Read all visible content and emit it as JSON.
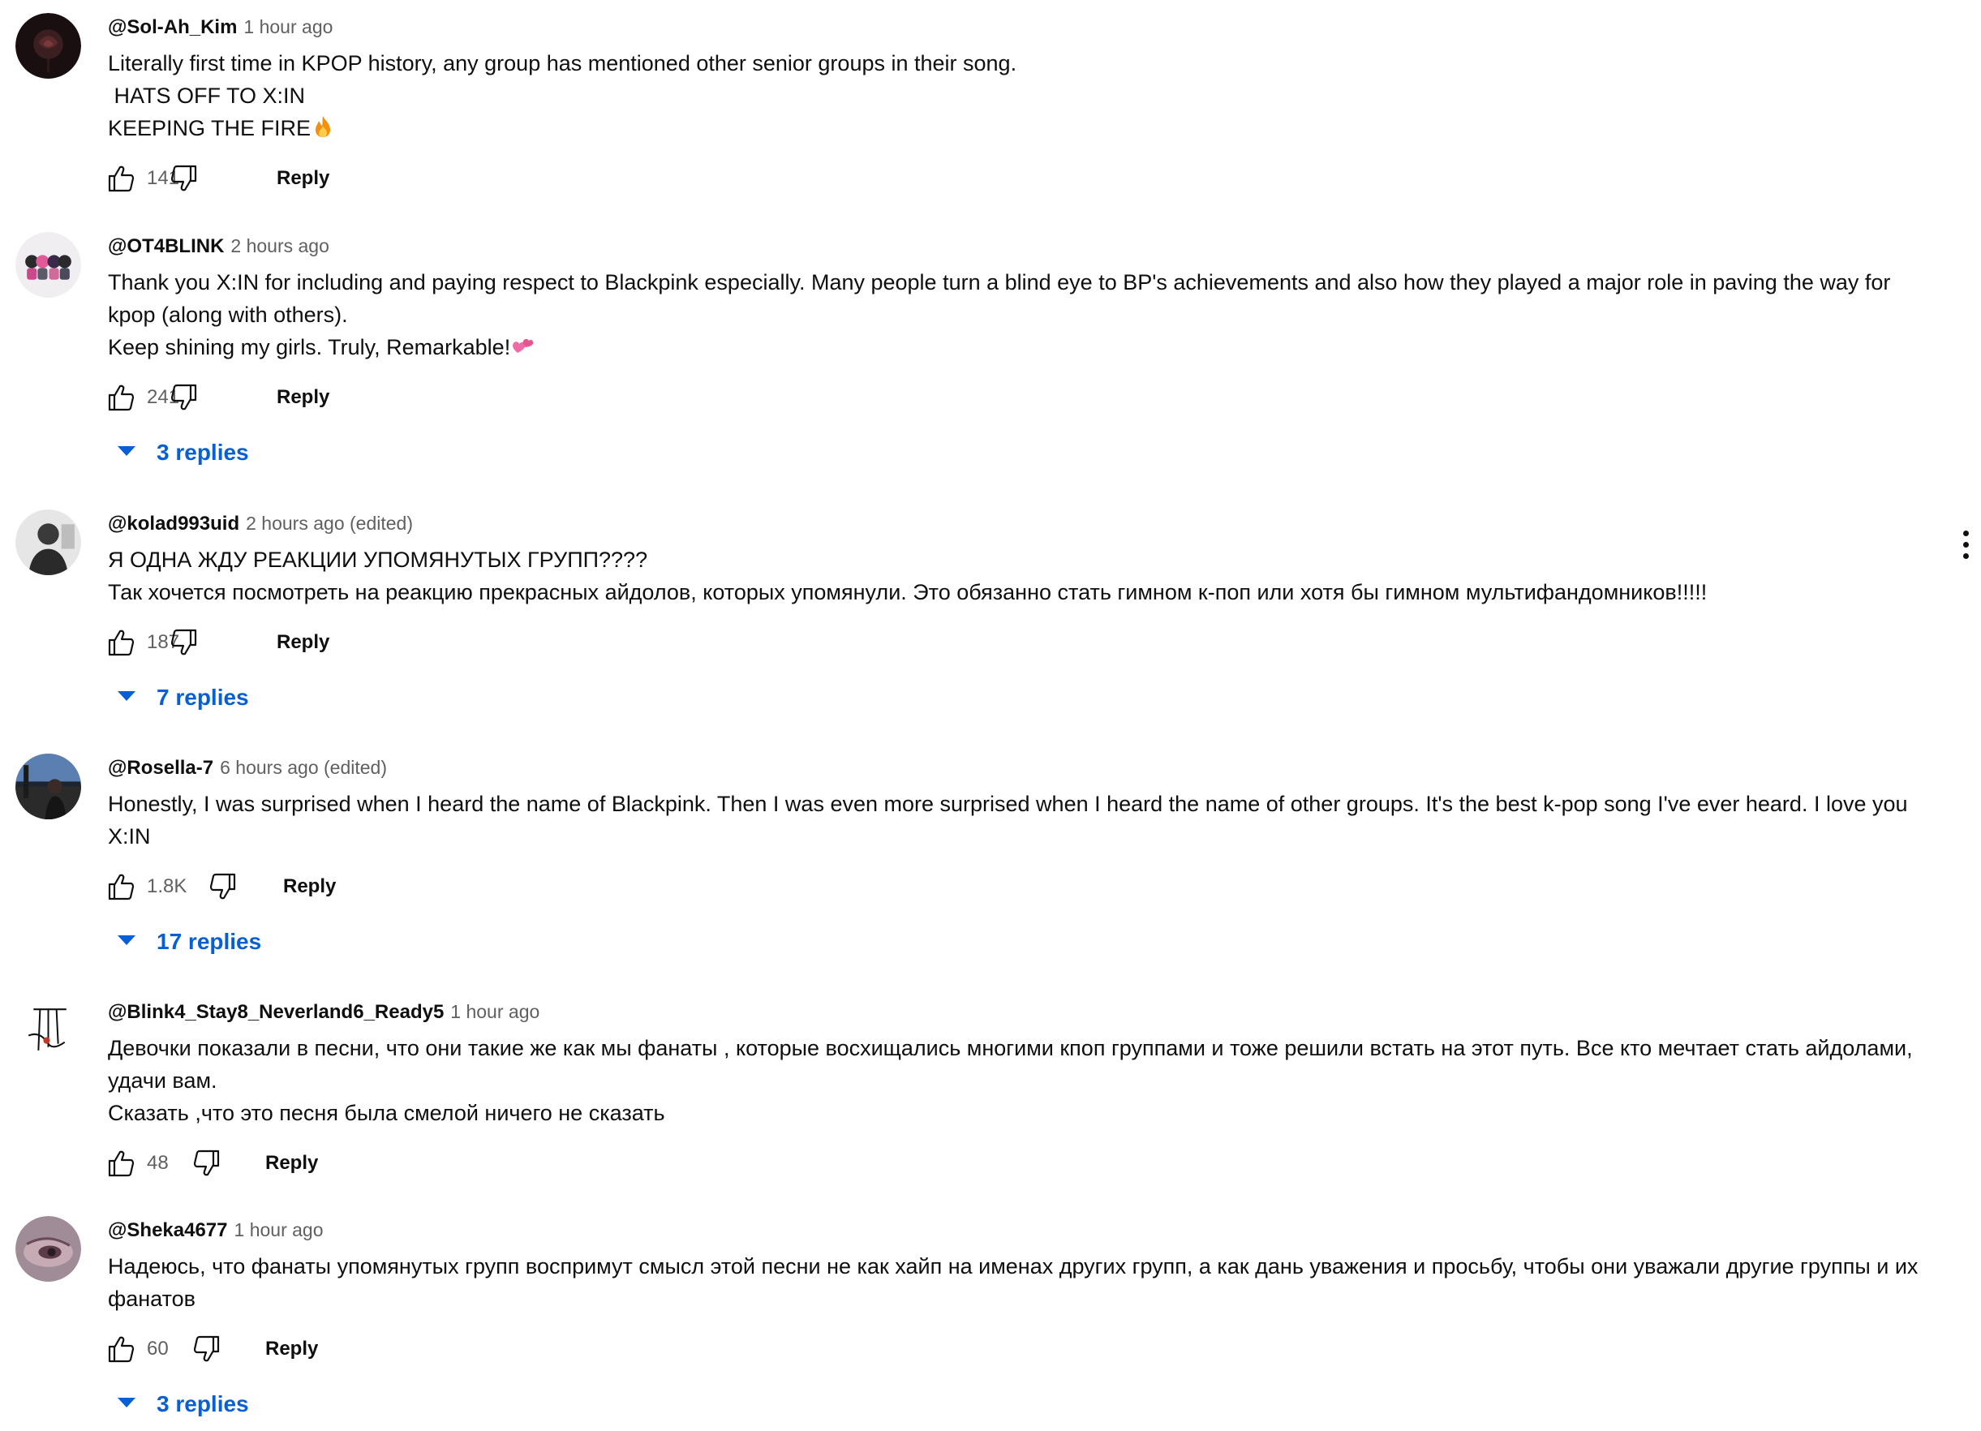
{
  "comments": [
    {
      "author": "@Sol-Ah_Kim",
      "time": "1 hour ago",
      "text": "Literally first time in KPOP history, any group has mentioned other senior groups in their song.\n HATS OFF TO X:IN\nKEEPING THE FIRE",
      "emoji": "fire-emoji",
      "likes": "141",
      "reply_label": "Reply"
    },
    {
      "author": "@OT4BLINK",
      "time": "2 hours ago",
      "text": "Thank you X:IN for including and paying respect to Blackpink especially. Many people turn a blind eye to BP's achievements and also how they played a major role in paving the way for kpop (along with others).\nKeep shining my girls. Truly, Remarkable!",
      "emoji": "two-hearts-emoji",
      "likes": "241",
      "reply_label": "Reply",
      "replies_label": "3 replies"
    },
    {
      "author": "@kolad993uid",
      "time": "2 hours ago (edited)",
      "text": "Я ОДНА ЖДУ РЕАКЦИИ УПОМЯНУТЫХ ГРУПП????\nТак хочется посмотреть на реакцию прекрасных айдолов, которых упомянули. Это обязанно стать гимном к-поп или хотя бы гимном мультифандомников!!!!!",
      "likes": "187",
      "reply_label": "Reply",
      "replies_label": "7 replies"
    },
    {
      "author": "@Rosella-7",
      "time": "6 hours ago (edited)",
      "text": "Honestly, I was surprised when I heard the name of Blackpink. Then I was even more surprised when I heard the name of other groups. It's the best k-pop song I've ever heard. I love you X:IN",
      "likes": "1.8K",
      "reply_label": "Reply",
      "replies_label": "17 replies"
    },
    {
      "author": "@Blink4_Stay8_Neverland6_Ready5",
      "time": "1 hour ago",
      "text": "Девочки показали в песни, что они такие же как мы фанаты , которые восхищались многими кпоп группами и тоже решили встать на этот путь. Все кто мечтает стать айдолами, удачи вам.\nСказать ,что это песня была смелой ничего не сказать",
      "likes": "48",
      "reply_label": "Reply"
    },
    {
      "author": "@Sheka4677",
      "time": "1 hour ago",
      "text": "Надеюсь, что фанаты упомянутых групп воспримут смысл этой песни не как хайп на именах других групп, а как дань уважения и просьбу, чтобы они уважали другие группы и их фанатов",
      "likes": "60",
      "reply_label": "Reply",
      "replies_label": "3 replies"
    }
  ],
  "icons": {
    "like": "thumbs-up-icon",
    "dislike": "thumbs-down-icon",
    "expand": "caret-down-icon",
    "menu": "more-vert-icon"
  },
  "colors": {
    "text": "#0f0f0f",
    "secondary": "#606060",
    "link": "#065fd4",
    "background": "#ffffff"
  }
}
